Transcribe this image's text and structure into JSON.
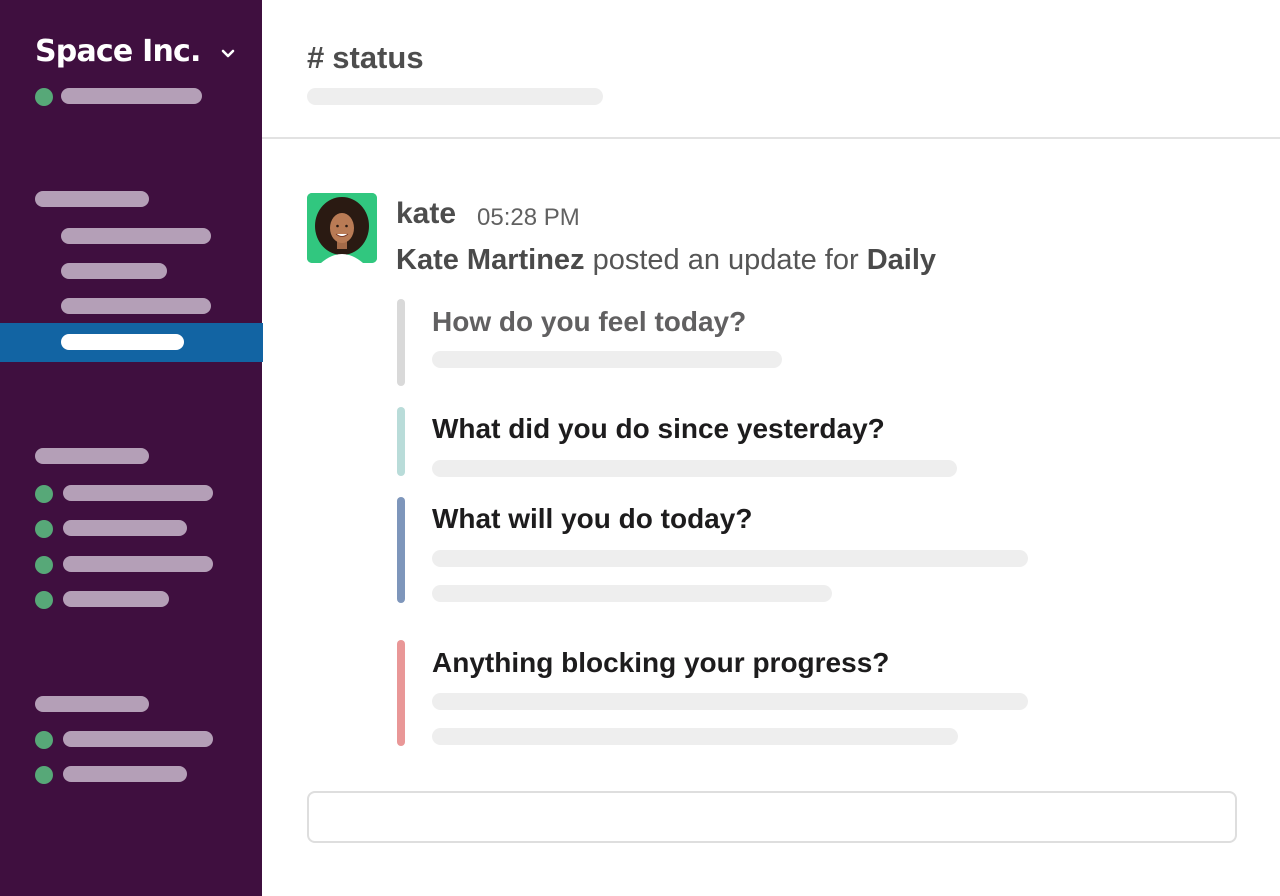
{
  "workspace": {
    "name": "Space Inc."
  },
  "channel": {
    "hash": "#",
    "name": "status"
  },
  "message": {
    "username": "kate",
    "timestamp": "05:28 PM",
    "author_full_name": "Kate Martinez",
    "text": "posted an update for",
    "report_name": "Daily"
  },
  "questions": [
    {
      "label": "How do you feel today?",
      "color": "#d9d9d9"
    },
    {
      "label": "What did you do since yesterday?",
      "color": "#b9dcd9"
    },
    {
      "label": "What will you do today?",
      "color": "#7e96bb"
    },
    {
      "label": "Anything blocking your progress?",
      "color": "#e99797"
    }
  ],
  "colors": {
    "sidebar_bg": "#3f0f3f",
    "active_item": "#1264a3",
    "presence": "#57a878",
    "avatar_bg": "#31c77f"
  }
}
